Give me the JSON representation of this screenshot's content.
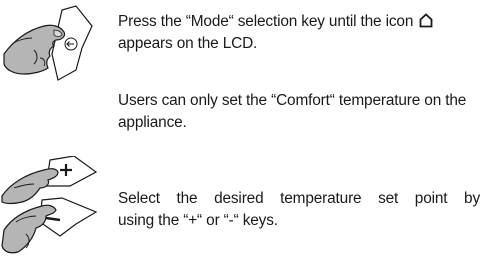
{
  "instructions": {
    "step_mode": {
      "text_before_icon": "Press the “Mode“ selection key until the icon",
      "text_after_icon": "appears on the LCD.",
      "icon": "home-icon"
    },
    "note_comfort": {
      "text": "Users can only set the “Comfort“ temperature on the appliance."
    },
    "step_setpoint": {
      "line1": "Select the desired temperature set point by",
      "line2": "using the “+“ or “-“ keys."
    }
  },
  "illustrations": {
    "mode_key": {
      "icon": "hand-pressing-mode-key-icon",
      "symbol": "←"
    },
    "plus_minus_keys": {
      "icon": "hand-pressing-plus-minus-keys-icon",
      "plus": "+",
      "minus": "–"
    }
  },
  "colors": {
    "text": "#1a1a1a",
    "hand_fill": "#b5b5b5",
    "key_fill": "#ffffff",
    "outline": "#1a1a1a"
  }
}
